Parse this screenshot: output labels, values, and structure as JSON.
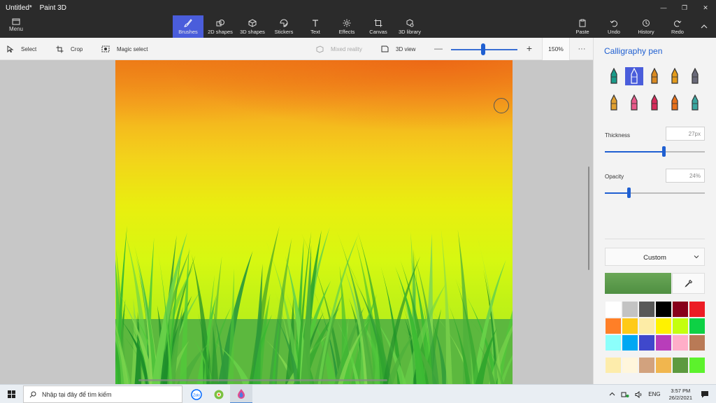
{
  "window": {
    "doc_title": "Untitled*",
    "app_name": "Paint 3D",
    "min_glyph": "—",
    "max_glyph": "❐",
    "close_glyph": "✕"
  },
  "ribbon": {
    "menu_label": "Menu",
    "tools": [
      {
        "label": "Brushes",
        "icon": "brush-icon",
        "active": true
      },
      {
        "label": "2D shapes",
        "icon": "2d-shapes-icon"
      },
      {
        "label": "3D shapes",
        "icon": "3d-shapes-icon"
      },
      {
        "label": "Stickers",
        "icon": "stickers-icon"
      },
      {
        "label": "Text",
        "icon": "text-icon"
      },
      {
        "label": "Effects",
        "icon": "effects-icon"
      },
      {
        "label": "Canvas",
        "icon": "canvas-icon"
      },
      {
        "label": "3D library",
        "icon": "3d-library-icon"
      }
    ],
    "actions": [
      {
        "label": "Paste",
        "icon": "paste-icon"
      },
      {
        "label": "Undo",
        "icon": "undo-icon"
      },
      {
        "label": "History",
        "icon": "history-icon"
      },
      {
        "label": "Redo",
        "icon": "redo-icon"
      }
    ]
  },
  "toolbar": {
    "select_label": "Select",
    "crop_label": "Crop",
    "magic_select_label": "Magic select",
    "mixed_reality_label": "Mixed reality",
    "view_3d_label": "3D view",
    "zoom_value": "150%",
    "zoom_level": 0.48,
    "more_glyph": "···"
  },
  "panel": {
    "title": "Calligraphy pen",
    "brushes": [
      {
        "name": "marker-brush-icon",
        "color": "#1a9b8a"
      },
      {
        "name": "calligraphy-pen-icon",
        "color": "#ffffff",
        "selected": true
      },
      {
        "name": "oil-brush-icon",
        "color": "#d98a22"
      },
      {
        "name": "watercolor-brush-icon",
        "color": "#e39b1c"
      },
      {
        "name": "pixel-pen-icon",
        "color": "#6a6a7a"
      },
      {
        "name": "pencil-icon",
        "color": "#e0a030"
      },
      {
        "name": "eraser-icon",
        "color": "#e85a8a"
      },
      {
        "name": "crayon-icon",
        "color": "#d62a5a"
      },
      {
        "name": "spray-can-icon",
        "color": "#e8701a"
      },
      {
        "name": "fill-bucket-icon",
        "color": "#3aa7a0"
      }
    ],
    "thickness_label": "Thickness",
    "thickness_value": "27px",
    "thickness_level": 0.59,
    "opacity_label": "Opacity",
    "opacity_value": "24%",
    "opacity_level": 0.24,
    "color_mode": "Custom",
    "current_color": "#4f8f42",
    "palette": [
      "#ffffff",
      "#c3c3c3",
      "#585858",
      "#000000",
      "#88001b",
      "#ec1c24",
      "#ff7f27",
      "#ffca18",
      "#fdeca6",
      "#fff200",
      "#c4ff0e",
      "#0ed145",
      "#8cfffb",
      "#00a8f3",
      "#3f48cc",
      "#b83dba",
      "#ffaec8",
      "#b97a56"
    ],
    "custom_palette": [
      "#fdecab",
      "#fff6dc",
      "#d2a27e",
      "#f1b64e",
      "#5d9a3f",
      "#5cf22c"
    ]
  },
  "taskbar": {
    "search_placeholder": "Nhập tại đây để tìm kiếm",
    "apps": [
      "zalo-app-icon",
      "coccoc-browser-icon",
      "paint-3d-app-icon"
    ],
    "lang": "ENG",
    "time": "3:57 PM",
    "date": "26/2/2021"
  }
}
